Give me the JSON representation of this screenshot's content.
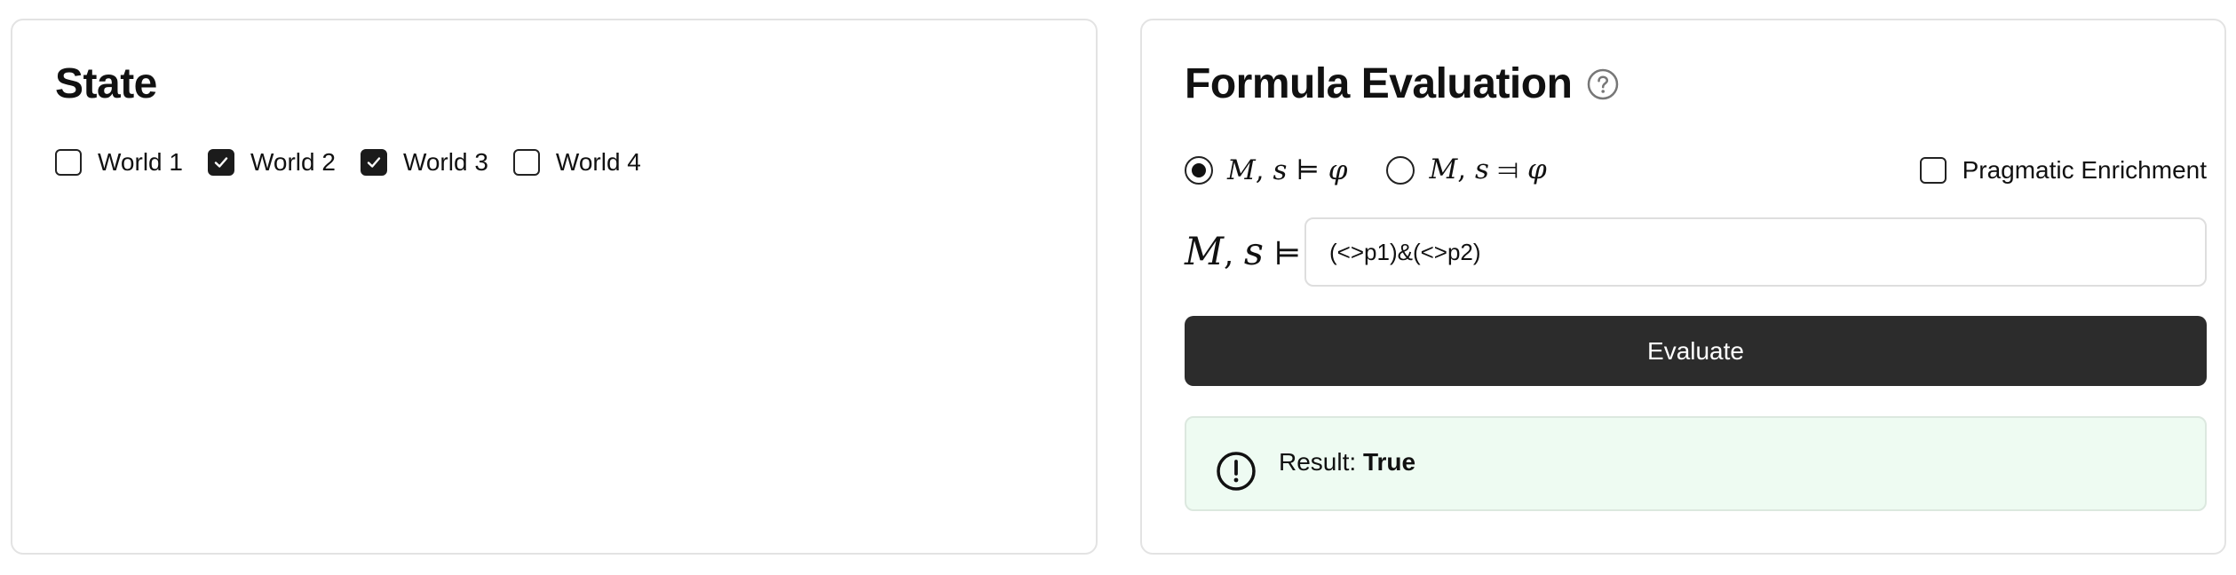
{
  "state": {
    "title": "State",
    "worlds": [
      {
        "label": "World 1",
        "checked": false
      },
      {
        "label": "World 2",
        "checked": true
      },
      {
        "label": "World 3",
        "checked": true
      },
      {
        "label": "World 4",
        "checked": false
      }
    ]
  },
  "formula": {
    "title": "Formula Evaluation",
    "help_icon": "question-circle-icon",
    "modes": [
      {
        "model": "M",
        "state": "s",
        "relation": "⊨",
        "formula": "φ",
        "selected": true
      },
      {
        "model": "M",
        "state": "s",
        "relation": "⫤",
        "formula": "φ",
        "selected": false
      }
    ],
    "pragmatic_label": "Pragmatic Enrichment",
    "pragmatic_checked": false,
    "prefix": {
      "model": "M",
      "state": "s",
      "relation": "⊨"
    },
    "input_value": "(<>p1)&(<>p2)",
    "evaluate_label": "Evaluate",
    "result": {
      "icon": "exclamation-circle-icon",
      "label": "Result:",
      "value": "True"
    }
  }
}
